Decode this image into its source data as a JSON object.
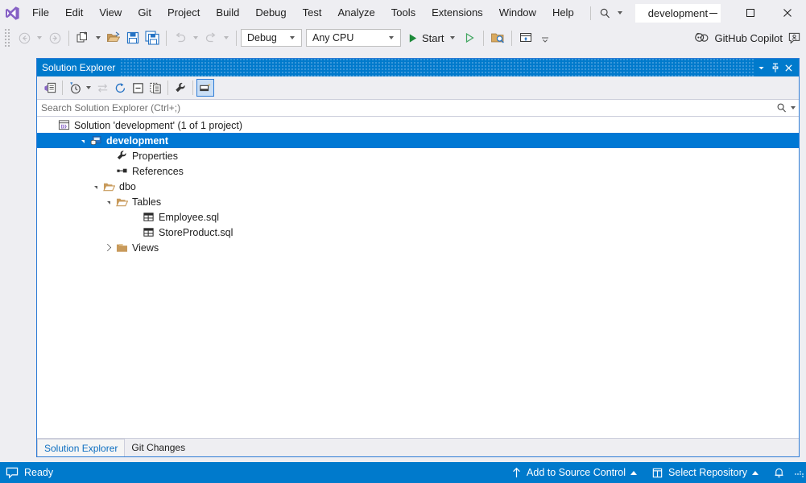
{
  "titlebar": {
    "logo_icon": "visual-studio-logo",
    "menus": [
      "File",
      "Edit",
      "View",
      "Git",
      "Project",
      "Build",
      "Debug",
      "Test",
      "Analyze",
      "Tools",
      "Extensions",
      "Window",
      "Help"
    ],
    "search_icon": "search-icon",
    "document_title": "development",
    "minimize_icon": "minimize-icon",
    "maximize_icon": "maximize-icon",
    "close_icon": "close-icon"
  },
  "toolbar": {
    "navigate_back_icon": "navigate-back-icon",
    "navigate_forward_icon": "navigate-forward-icon",
    "new_project_icon": "new-project-icon",
    "open_file_icon": "open-file-icon",
    "save_icon": "save-icon",
    "save_all_icon": "save-all-icon",
    "undo_icon": "undo-icon",
    "redo_icon": "redo-icon",
    "configuration": "Debug",
    "platform": "Any CPU",
    "start_label": "Start",
    "start_icon": "play-icon",
    "start_without_debugging_icon": "play-outline-icon",
    "find_in_files_icon": "find-in-files-icon",
    "window_layout_icon": "window-layout-icon",
    "overflow_icon": "toolbar-overflow-icon",
    "copilot_label": "GitHub Copilot",
    "copilot_icon": "github-copilot-icon",
    "copilot_chat_icon": "copilot-chat-icon"
  },
  "panel": {
    "title": "Solution Explorer",
    "header_dropdown_icon": "chevron-down-icon",
    "pin_icon": "pin-icon",
    "close_icon": "close-icon",
    "toolbar_buttons": [
      {
        "name": "solution-explorer-home-icon",
        "label": "Home"
      },
      {
        "name": "pending-changes-filter-icon",
        "label": "Pending Changes Filter"
      },
      {
        "name": "sync-with-active-document-icon",
        "label": "Sync with Active Document"
      },
      {
        "name": "refresh-icon",
        "label": "Refresh"
      },
      {
        "name": "collapse-all-icon",
        "label": "Collapse All"
      },
      {
        "name": "show-all-files-icon",
        "label": "Show All Files"
      },
      {
        "name": "properties-icon",
        "label": "Properties"
      },
      {
        "name": "preview-selected-items-icon",
        "label": "Preview Selected Items"
      }
    ],
    "search": {
      "placeholder": "Search Solution Explorer (Ctrl+;)",
      "icon": "search-icon",
      "dropdown_icon": "chevron-down-icon"
    }
  },
  "tree": {
    "nodes": [
      {
        "label": "Solution 'development' (1 of 1 project)",
        "icon": "solution-icon",
        "indent": 0,
        "expander": "none",
        "selected": false
      },
      {
        "label": "development",
        "icon": "database-project-icon",
        "indent": 1,
        "expander": "expanded",
        "selected": true
      },
      {
        "label": "Properties",
        "icon": "wrench-icon",
        "indent": 3,
        "expander": "none",
        "selected": false
      },
      {
        "label": "References",
        "icon": "references-icon",
        "indent": 3,
        "expander": "none",
        "selected": false
      },
      {
        "label": "dbo",
        "icon": "folder-open-icon",
        "indent": 2,
        "expander": "expanded",
        "selected": false
      },
      {
        "label": "Tables",
        "icon": "folder-open-icon",
        "indent": 3,
        "expander": "expanded",
        "selected": false
      },
      {
        "label": "Employee.sql",
        "icon": "sql-table-icon",
        "indent": 5,
        "expander": "none",
        "selected": false
      },
      {
        "label": "StoreProduct.sql",
        "icon": "sql-table-icon",
        "indent": 5,
        "expander": "none",
        "selected": false
      },
      {
        "label": "Views",
        "icon": "folder-closed-icon",
        "indent": 3,
        "expander": "collapsed",
        "selected": false
      }
    ]
  },
  "bottom_tabs": [
    {
      "label": "Solution Explorer",
      "active": true
    },
    {
      "label": "Git Changes",
      "active": false
    }
  ],
  "statusbar": {
    "ready_icon": "ready-icon",
    "ready_text": "Ready",
    "source_control_icon": "arrow-up-icon",
    "source_control_label": "Add to Source Control",
    "repository_icon": "repository-icon",
    "repository_label": "Select Repository",
    "notifications_icon": "bell-icon"
  },
  "colors": {
    "accent": "#007ACC",
    "selection": "#0078D4",
    "chrome": "#EEEEF2",
    "panel_border": "#2E7CD6",
    "folder": "#C89A5B",
    "logo_purple": "#8661C5"
  }
}
